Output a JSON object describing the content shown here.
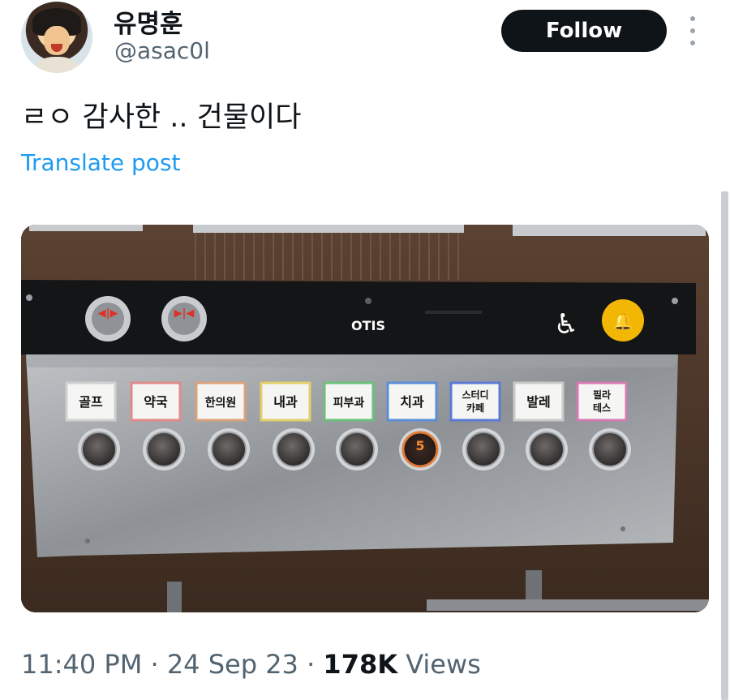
{
  "user": {
    "display_name": "유명훈",
    "handle": "@asac0l"
  },
  "follow_label": "Follow",
  "post": {
    "text": "ㄹㅇ 감사한 .. 건물이다",
    "translate_label": "Translate post"
  },
  "photo": {
    "brand": "OTIS",
    "floor_labels": [
      "골프",
      "약국",
      "한의원",
      "내과",
      "피부과",
      "치과",
      "스터디\n카페",
      "발레",
      "필라\n테스"
    ],
    "lit_button_number": "5",
    "colors": {
      "panel_black": "#141516",
      "steel": "#a9adb0",
      "wall": "#4a3527",
      "alarm": "#f2b705"
    }
  },
  "meta": {
    "time": "11:40 PM",
    "separator": "·",
    "date": "24 Sep 23",
    "views_count": "178K",
    "views_label": "Views"
  },
  "colors": {
    "link": "#1d9bf0",
    "muted": "#536471",
    "text": "#0f1419"
  }
}
